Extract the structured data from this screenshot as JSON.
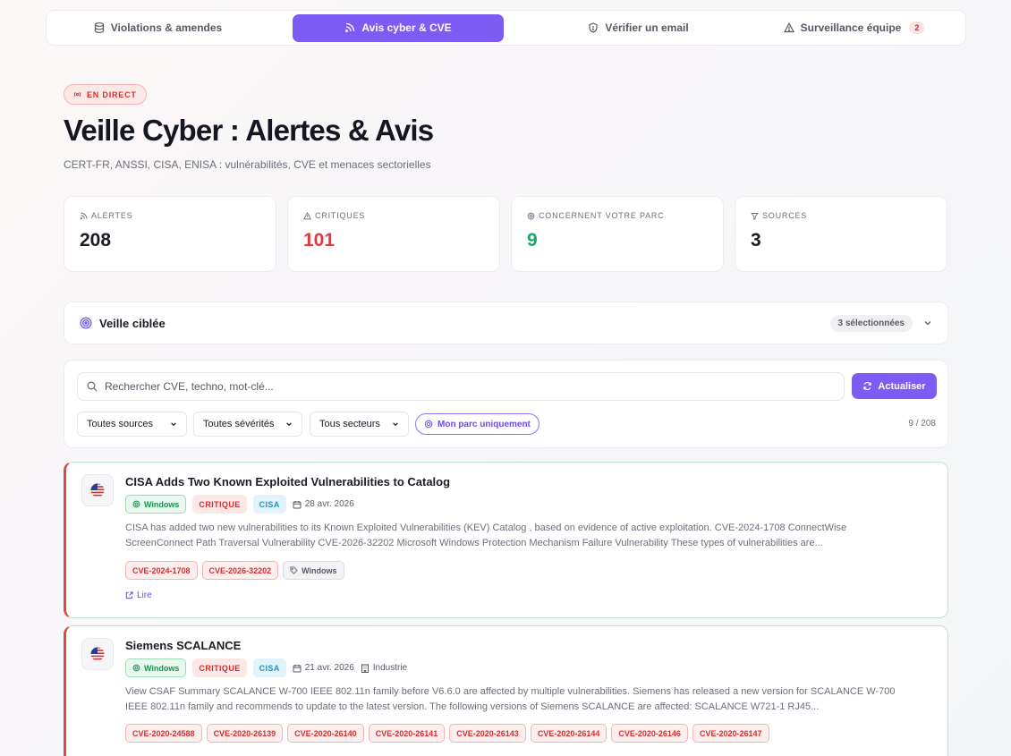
{
  "tabs": [
    {
      "label": "Violations & amendes",
      "icon": "database-icon"
    },
    {
      "label": "Avis cyber & CVE",
      "icon": "rss-icon",
      "active": true
    },
    {
      "label": "Vérifier un email",
      "icon": "shield-icon"
    },
    {
      "label": "Surveillance équipe",
      "icon": "warning-icon",
      "count": "2"
    }
  ],
  "header": {
    "badge": "EN DIRECT",
    "title": "Veille Cyber : Alertes & Avis",
    "subtitle": "CERT-FR, ANSSI, CISA, ENISA : vulnérabilités, CVE et menaces sectorielles"
  },
  "stats": [
    {
      "label": "ALERTES",
      "value": "208",
      "color": "#1a1c26",
      "icon": "rss-icon"
    },
    {
      "label": "CRITIQUES",
      "value": "101",
      "color": "#e0393e",
      "icon": "warning-icon"
    },
    {
      "label": "CONCERNENT VOTRE PARC",
      "value": "9",
      "color": "#16a864",
      "icon": "target-icon"
    },
    {
      "label": "SOURCES",
      "value": "3",
      "color": "#1a1c26",
      "icon": "filter-icon"
    }
  ],
  "veille": {
    "title": "Veille ciblée",
    "selected": "3 sélectionnées"
  },
  "filters": {
    "search_placeholder": "Rechercher CVE, techno, mot-clé...",
    "refresh_label": "Actualiser",
    "source": "Toutes sources",
    "severity": "Toutes sévérités",
    "sector": "Tous secteurs",
    "mine_label": "Mon parc uniquement",
    "counter": "9 / 208"
  },
  "alerts": [
    {
      "title": "CISA Adds Two Known Exploited Vulnerabilities to Catalog",
      "platform": "Windows",
      "severity": "CRITIQUE",
      "source": "CISA",
      "date": "28 avr. 2026",
      "sector": "",
      "description": "CISA has added two new vulnerabilities to its Known Exploited Vulnerabilities (KEV) Catalog , based on evidence of active exploitation. CVE-2024-1708 ConnectWise ScreenConnect Path Traversal Vulnerability CVE-2026-32202 Microsoft Windows Protection Mechanism Failure Vulnerability These types of vulnerabilities are...",
      "cves": [
        "CVE-2024-1708",
        "CVE-2026-32202"
      ],
      "tags": [
        "Windows"
      ],
      "read_label": "Lire"
    },
    {
      "title": "Siemens SCALANCE",
      "platform": "Windows",
      "severity": "CRITIQUE",
      "source": "CISA",
      "date": "21 avr. 2026",
      "sector": "Industrie",
      "description": "View CSAF Summary SCALANCE W-700 IEEE 802.11n family before V6.6.0 are affected by multiple vulnerabilities. Siemens has released a new version for SCALANCE W-700 IEEE 802.11n family and recommends to update to the latest version. The following versions of Siemens SCALANCE are affected: SCALANCE W721-1 RJ45...",
      "cves": [
        "CVE-2020-24588",
        "CVE-2020-26139",
        "CVE-2020-26140",
        "CVE-2020-26141",
        "CVE-2020-26143",
        "CVE-2020-26144",
        "CVE-2020-26146",
        "CVE-2020-26147"
      ],
      "tags": []
    }
  ]
}
